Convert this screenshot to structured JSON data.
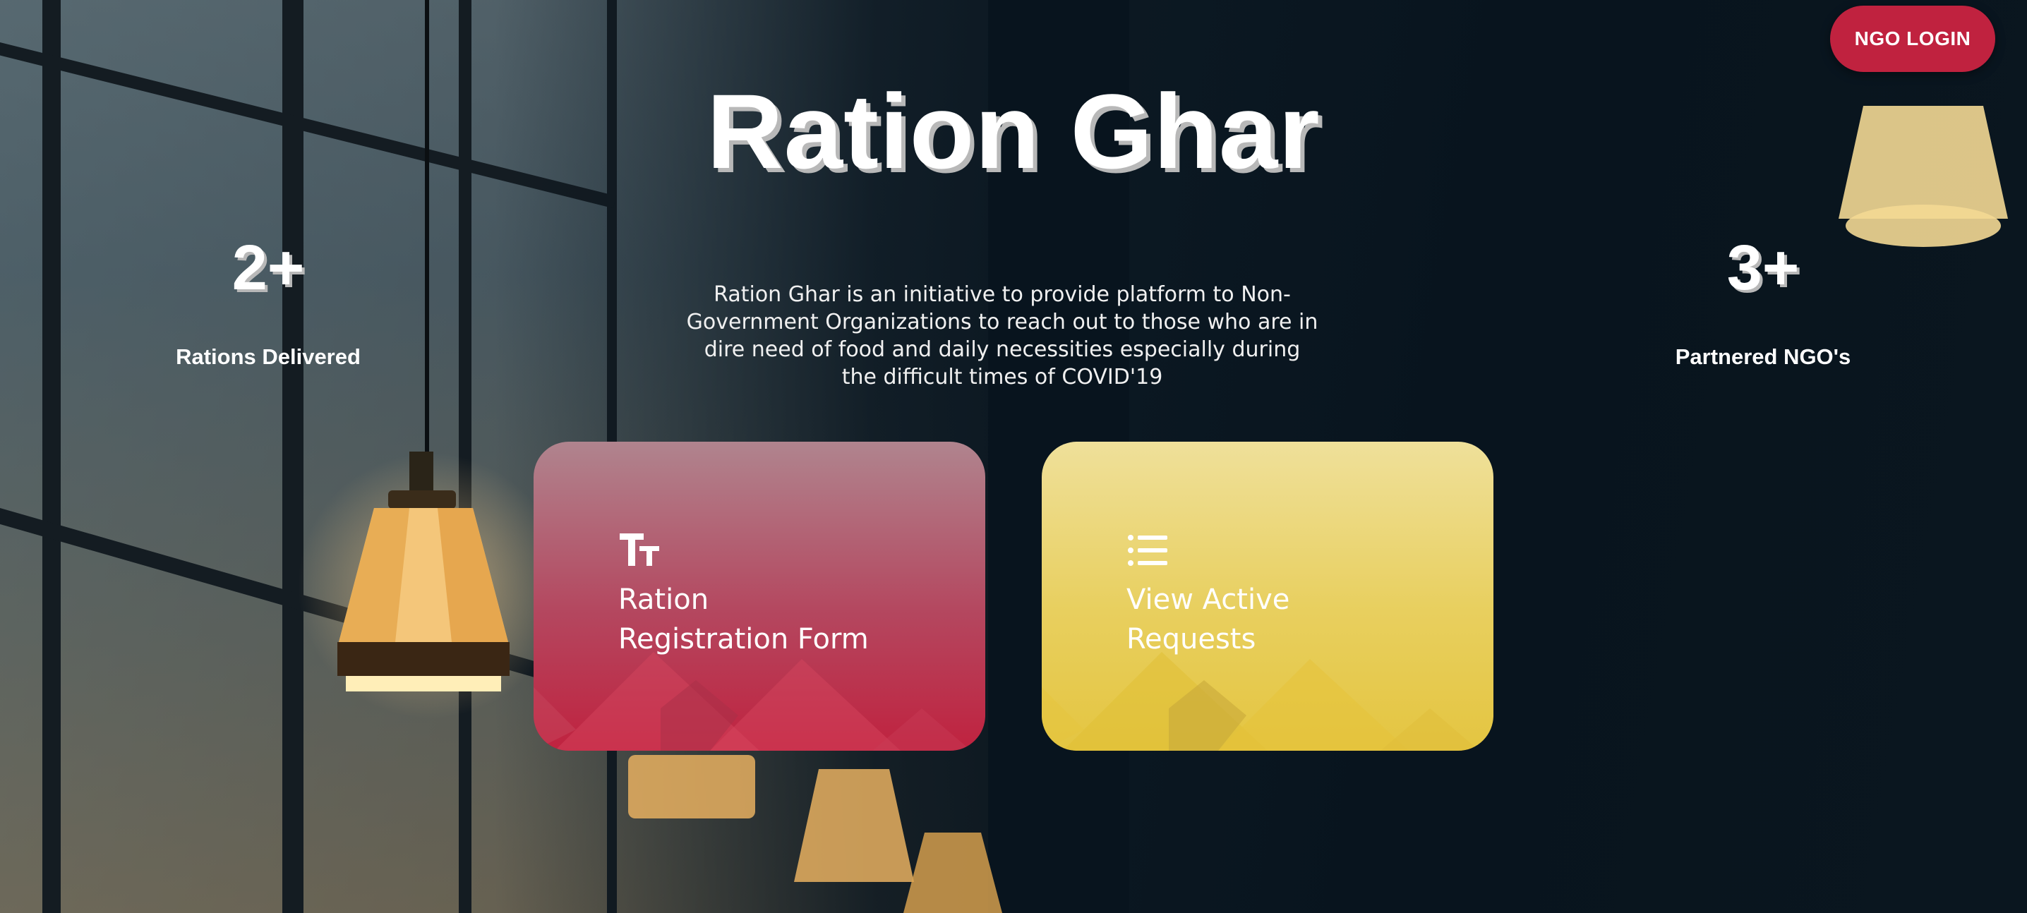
{
  "header": {
    "login_label": "NGO LOGIN"
  },
  "hero": {
    "title": "Ration Ghar",
    "description": "Ration Ghar is an initiative to provide platform to Non-Government Organizations to reach out to those who are in dire need of food and daily necessities especially during the difficult times of COVID'19"
  },
  "stats": [
    {
      "value": "2+",
      "label": "Rations Delivered"
    },
    {
      "value": "3+",
      "label": "Partnered NGO's"
    }
  ],
  "cards": [
    {
      "line1": "Ration",
      "line2": "Registration Form",
      "icon": "text-size-icon",
      "color": "#c0223f"
    },
    {
      "line1": "View Active",
      "line2": "Requests",
      "icon": "list-icon",
      "color": "#e4c541"
    }
  ],
  "colors": {
    "accent": "#c0223f",
    "secondary": "#e4c541",
    "background": "#0b1822"
  }
}
